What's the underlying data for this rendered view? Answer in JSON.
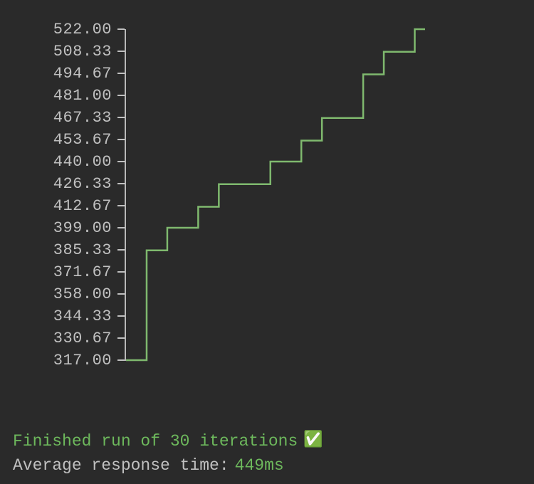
{
  "chart_data": {
    "type": "line",
    "title": "",
    "xlabel": "",
    "ylabel": "",
    "ylim": [
      317.0,
      522.0
    ],
    "step_style": true,
    "y_ticks": [
      "522.00",
      "508.33",
      "494.67",
      "481.00",
      "467.33",
      "453.67",
      "440.00",
      "426.33",
      "412.67",
      "399.00",
      "385.33",
      "371.67",
      "358.00",
      "344.33",
      "330.67",
      "317.00"
    ],
    "x": [
      0,
      1,
      2,
      3,
      4,
      5,
      6,
      7,
      8,
      9,
      10,
      11,
      12,
      13,
      14,
      15,
      16,
      17,
      18,
      19,
      20,
      21,
      22,
      23,
      24,
      25,
      26,
      27,
      28,
      29
    ],
    "values": [
      317,
      317,
      385,
      385,
      399,
      399,
      399,
      412,
      412,
      426,
      426,
      426,
      426,
      426,
      440,
      440,
      440,
      453,
      453,
      467,
      467,
      467,
      467,
      494,
      494,
      508,
      508,
      508,
      522,
      522
    ]
  },
  "status": {
    "finished_text": "Finished run of 30 iterations",
    "check_emoji": "✅",
    "avg_label": "Average response time:",
    "avg_value": "449ms"
  },
  "colors": {
    "bg": "#2a2a2a",
    "text": "#c0c0c0",
    "accent_green": "#6db85c",
    "line_green": "#7fb96e"
  }
}
